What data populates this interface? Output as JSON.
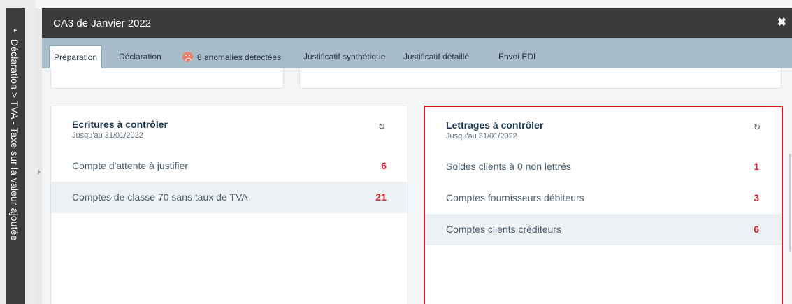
{
  "sidebar": {
    "arrow": "▸",
    "breadcrumb": "Déclaration > TVA - Taxe sur la valeur ajoutée"
  },
  "header": {
    "title": "CA3 de Janvier 2022",
    "close": "✖"
  },
  "tabs": [
    {
      "label": "Préparation",
      "active": true
    },
    {
      "label": "Déclaration"
    },
    {
      "label": "8 anomalies détectées",
      "icon": "sad-face-icon"
    },
    {
      "label": "Justificatif synthétique"
    },
    {
      "label": "Justificatif détaillé"
    },
    {
      "label": "Envoi EDI"
    }
  ],
  "cards": [
    {
      "title": "Ecritures à contrôler",
      "subtitle": "Jusqu'au 31/01/2022",
      "refresh": "↻",
      "rows": [
        {
          "label": "Compte d'attente à justifier",
          "count": "6"
        },
        {
          "label": "Comptes de classe 70 sans taux de TVA",
          "count": "21"
        }
      ]
    },
    {
      "title": "Lettrages à contrôler",
      "subtitle": "Jusqu'au 31/01/2022",
      "refresh": "↻",
      "rows": [
        {
          "label": "Soldes clients à 0 non lettrés",
          "count": "1"
        },
        {
          "label": "Comptes fournisseurs débiteurs",
          "count": "3"
        },
        {
          "label": "Comptes clients créditeurs",
          "count": "6"
        }
      ]
    }
  ],
  "colors": {
    "header_bg": "#3b3b3b",
    "tabs_bg": "#a8bdca",
    "count": "#d4242f",
    "highlight": "#d71920"
  }
}
